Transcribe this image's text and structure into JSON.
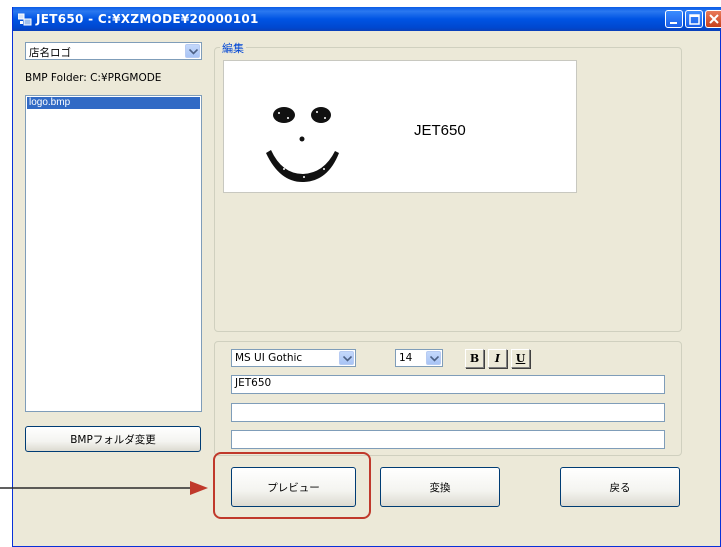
{
  "window": {
    "title": "JET650 - C:¥XZMODE¥20000101"
  },
  "left_panel": {
    "store_combo_value": "店名ロゴ",
    "bmp_folder_text": "BMP Folder: C:¥PRGMODE",
    "files": [
      "logo.bmp"
    ],
    "change_folder_label": "BMPフォルダ変更"
  },
  "edit_group": {
    "caption": "編集",
    "preview_text": "JET650"
  },
  "text_group": {
    "font_value": "MS UI Gothic",
    "size_value": "14",
    "bold_label": "B",
    "italic_label": "I",
    "underline_label": "U",
    "line1": "JET650",
    "line2": "",
    "line3": ""
  },
  "bottom_buttons": {
    "preview": "プレビュー",
    "convert": "変換",
    "back": "戻る"
  },
  "colors": {
    "titlebar": "#0054e3",
    "highlight": "#c0392b",
    "selection": "#316ac5"
  }
}
